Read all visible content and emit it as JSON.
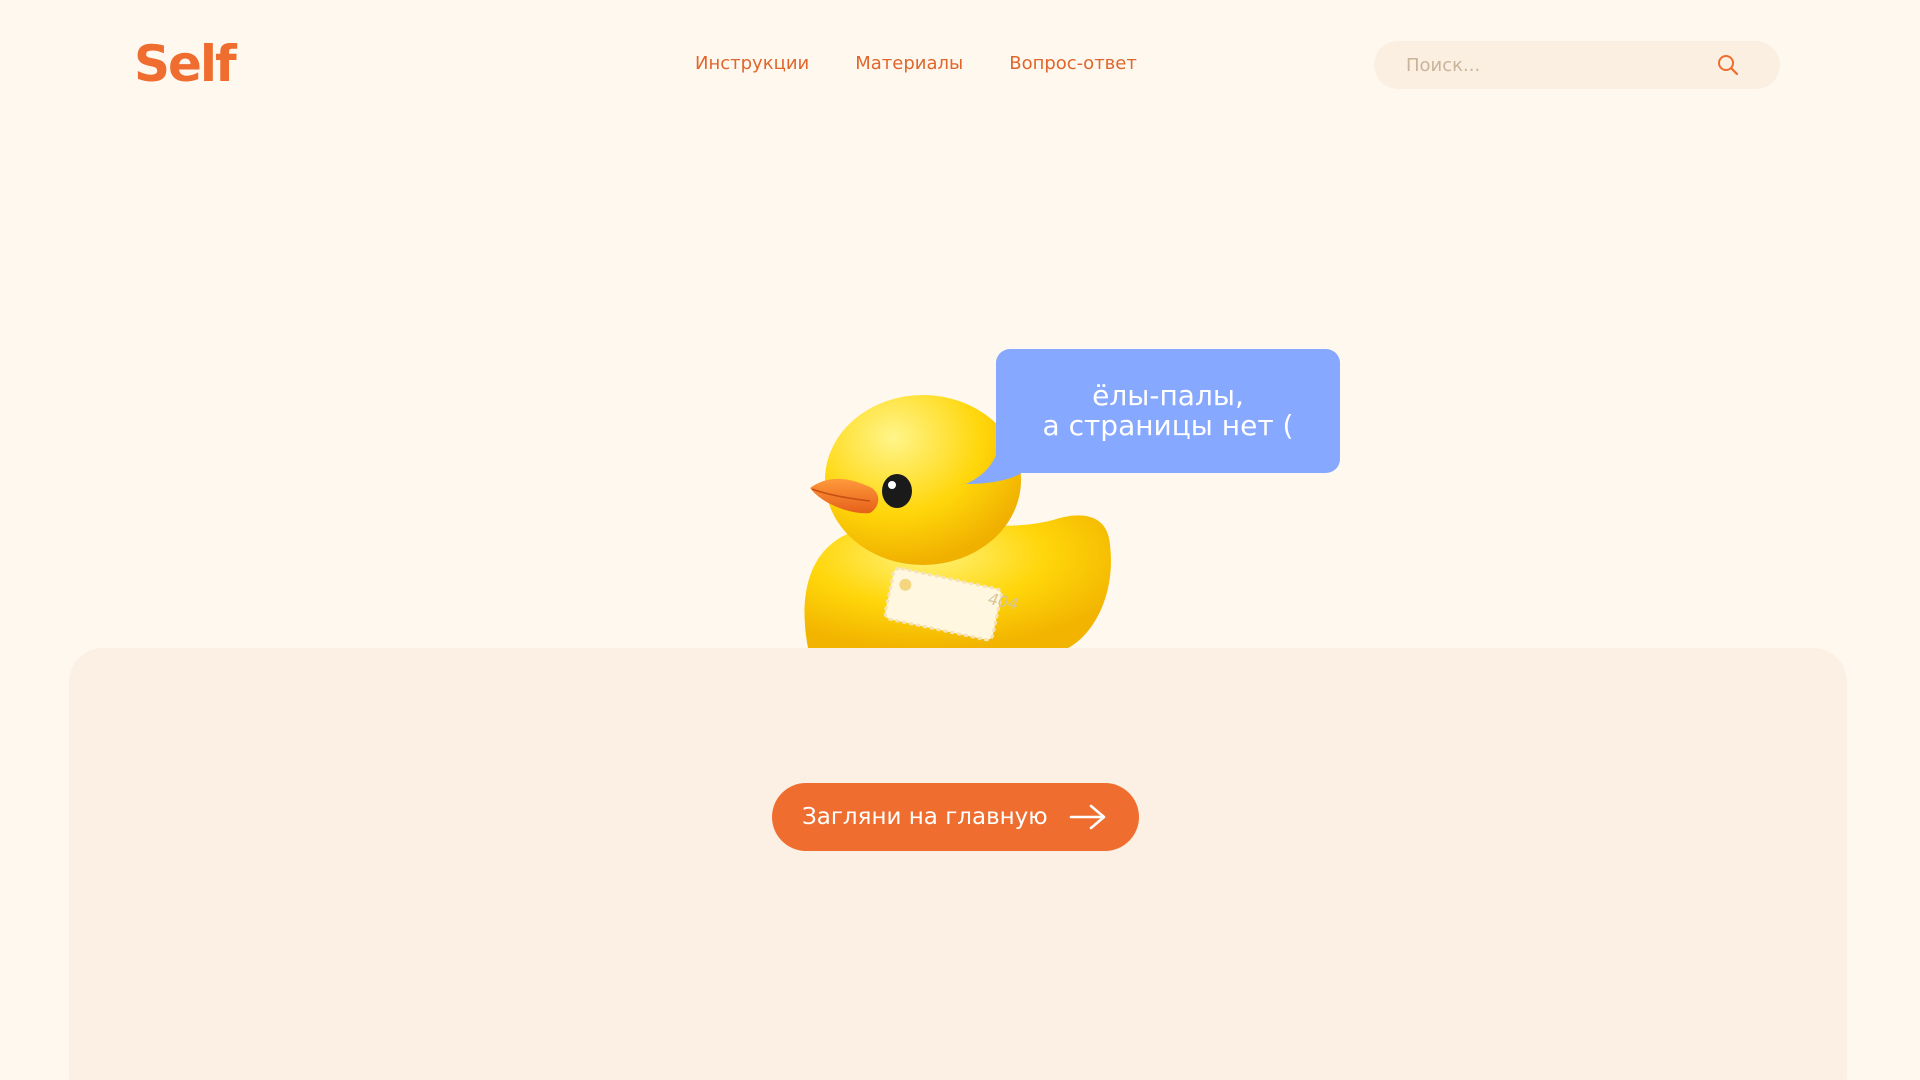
{
  "header": {
    "logo_text": "Self",
    "nav": [
      {
        "label": "Инструкции"
      },
      {
        "label": "Материалы"
      },
      {
        "label": "Вопрос-ответ"
      }
    ],
    "search": {
      "placeholder": "Поиск...",
      "value": "",
      "icon": "search-icon"
    }
  },
  "hero": {
    "bubble_line1": "ёлы-палы,",
    "bubble_line2": "а страницы нет (",
    "tag_text": "404",
    "illustration": "rubber-duck"
  },
  "cta": {
    "label": "Загляни на главную",
    "icon": "arrow-right-icon"
  },
  "colors": {
    "background": "#fff8ef",
    "panel": "#fbf0e3",
    "accent": "#ef6d2f",
    "bubble": "#86a8ff",
    "duck": "#ffd20a"
  }
}
